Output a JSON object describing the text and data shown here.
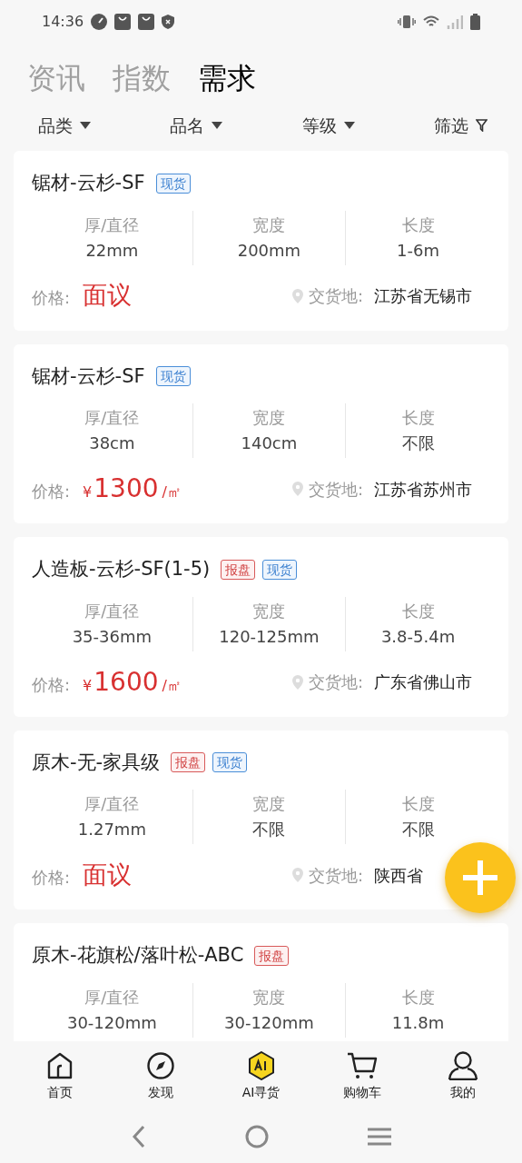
{
  "status_bar": {
    "time": "14:36"
  },
  "tabs": [
    {
      "label": "资讯",
      "selected": false
    },
    {
      "label": "指数",
      "selected": false
    },
    {
      "label": "需求",
      "selected": true
    }
  ],
  "filters": [
    {
      "label": "品类",
      "kind": "dropdown"
    },
    {
      "label": "品名",
      "kind": "dropdown"
    },
    {
      "label": "等级",
      "kind": "dropdown"
    },
    {
      "label": "筛选",
      "kind": "filter"
    }
  ],
  "listings": [
    {
      "title": "锯材-云杉-SF",
      "tags": [
        {
          "label": "现货",
          "kind": "spot"
        }
      ],
      "specs": [
        {
          "label": "厚/直径",
          "value": "22mm"
        },
        {
          "label": "宽度",
          "value": "200mm"
        },
        {
          "label": "长度",
          "value": "1-6m"
        }
      ],
      "price_label": "价格:",
      "price": {
        "kind": "negotiable",
        "text": "面议"
      },
      "delivery_label": "交货地:",
      "delivery": "江苏省无锡市"
    },
    {
      "title": "锯材-云杉-SF",
      "tags": [
        {
          "label": "现货",
          "kind": "spot"
        }
      ],
      "specs": [
        {
          "label": "厚/直径",
          "value": "38cm"
        },
        {
          "label": "宽度",
          "value": "140cm"
        },
        {
          "label": "长度",
          "value": "不限"
        }
      ],
      "price_label": "价格:",
      "price": {
        "kind": "amount",
        "currency": "¥",
        "amount": "1300",
        "unit": "/㎡"
      },
      "delivery_label": "交货地:",
      "delivery": "江苏省苏州市"
    },
    {
      "title": "人造板-云杉-SF(1-5)",
      "tags": [
        {
          "label": "报盘",
          "kind": "offer"
        },
        {
          "label": "现货",
          "kind": "spot"
        }
      ],
      "specs": [
        {
          "label": "厚/直径",
          "value": "35-36mm"
        },
        {
          "label": "宽度",
          "value": "120-125mm"
        },
        {
          "label": "长度",
          "value": "3.8-5.4m"
        }
      ],
      "price_label": "价格:",
      "price": {
        "kind": "amount",
        "currency": "¥",
        "amount": "1600",
        "unit": "/㎡"
      },
      "delivery_label": "交货地:",
      "delivery": "广东省佛山市"
    },
    {
      "title": "原木-无-家具级",
      "tags": [
        {
          "label": "报盘",
          "kind": "offer"
        },
        {
          "label": "现货",
          "kind": "spot"
        }
      ],
      "specs": [
        {
          "label": "厚/直径",
          "value": "1.27mm"
        },
        {
          "label": "宽度",
          "value": "不限"
        },
        {
          "label": "长度",
          "value": "不限"
        }
      ],
      "price_label": "价格:",
      "price": {
        "kind": "negotiable",
        "text": "面议"
      },
      "delivery_label": "交货地:",
      "delivery": "陕西省"
    },
    {
      "title": "原木-花旗松/落叶松-ABC",
      "tags": [
        {
          "label": "报盘",
          "kind": "offer"
        }
      ],
      "specs": [
        {
          "label": "厚/直径",
          "value": "30-120mm"
        },
        {
          "label": "宽度",
          "value": "30-120mm"
        },
        {
          "label": "长度",
          "value": "11.8m"
        }
      ]
    }
  ],
  "bottom_nav": [
    {
      "label": "首页",
      "kind": "home"
    },
    {
      "label": "发现",
      "kind": "compass"
    },
    {
      "label": "AI寻货",
      "kind": "ai"
    },
    {
      "label": "购物车",
      "kind": "cart"
    },
    {
      "label": "我的",
      "kind": "user"
    }
  ]
}
